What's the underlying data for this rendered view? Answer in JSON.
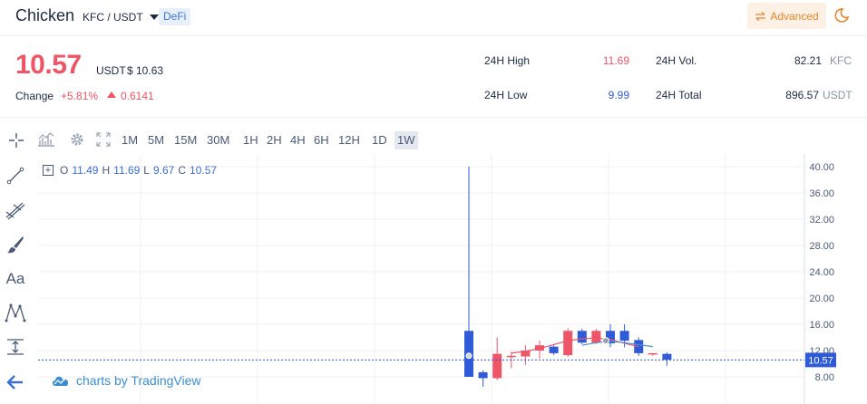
{
  "header": {
    "coin_name": "Chicken",
    "pair": "KFC / USDT",
    "badge": "DeFi",
    "advanced_label": "Advanced"
  },
  "ticker": {
    "price": "10.57",
    "price_unit": "USDT",
    "price_fiat": "$ 10.63",
    "change_label": "Change",
    "change_pct": "+5.81%",
    "change_abs": "0.6141",
    "high_label": "24H High",
    "high_value": "11.69",
    "low_label": "24H Low",
    "low_value": "9.99",
    "vol_label": "24H Vol.",
    "vol_value": "82.21",
    "vol_unit": "KFC",
    "total_label": "24H Total",
    "total_value": "896.57",
    "total_unit": "USDT"
  },
  "colors": {
    "up": "#ee5567",
    "down": "#2f5ad8",
    "accent": "#e8862d",
    "high": "#ee5567",
    "low": "#2f5ad8"
  },
  "toolbar": {
    "intervals": [
      "1M",
      "5M",
      "15M",
      "30M",
      "1H",
      "2H",
      "4H",
      "6H",
      "12H",
      "1D",
      "1W"
    ],
    "active_interval": "1W",
    "icons": [
      "crosshair-icon",
      "indicators-icon",
      "settings-icon",
      "fullscreen-icon"
    ]
  },
  "tools": [
    "crosshair-icon",
    "trend-line-icon",
    "fib-icon",
    "brush-icon",
    "text-tool",
    "pattern-icon",
    "measure-icon",
    "back-arrow-icon"
  ],
  "text_tool_label": "Aa",
  "ohlc": {
    "o_label": "O",
    "o": "11.49",
    "h_label": "H",
    "h": "11.69",
    "l_label": "L",
    "l": "9.67",
    "c_label": "C",
    "c": "10.57"
  },
  "watermark": "charts by TradingView",
  "chart_data": {
    "type": "candlestick",
    "y_ticks": [
      "40.00",
      "36.00",
      "32.00",
      "28.00",
      "24.00",
      "20.00",
      "16.00",
      "12.00",
      "8.00"
    ],
    "ylim": [
      4.5,
      40.5
    ],
    "last_price": "10.57",
    "candles": [
      {
        "o": 15.0,
        "h": 40.0,
        "l": 8.0,
        "c": 8.0
      },
      {
        "o": 8.7,
        "h": 9.0,
        "l": 6.5,
        "c": 7.8
      },
      {
        "o": 7.8,
        "h": 14.0,
        "l": 7.5,
        "c": 11.5
      },
      {
        "o": 11.0,
        "h": 11.8,
        "l": 9.3,
        "c": 11.2
      },
      {
        "o": 11.1,
        "h": 12.8,
        "l": 9.8,
        "c": 12.0
      },
      {
        "o": 12.0,
        "h": 13.5,
        "l": 10.8,
        "c": 12.8
      },
      {
        "o": 12.6,
        "h": 12.8,
        "l": 11.3,
        "c": 11.6
      },
      {
        "o": 11.3,
        "h": 15.4,
        "l": 11.0,
        "c": 15.0
      },
      {
        "o": 15.0,
        "h": 15.3,
        "l": 13.0,
        "c": 13.2
      },
      {
        "o": 13.2,
        "h": 15.3,
        "l": 13.0,
        "c": 15.0
      },
      {
        "o": 15.0,
        "h": 16.0,
        "l": 12.5,
        "c": 13.1
      },
      {
        "o": 15.0,
        "h": 16.0,
        "l": 12.5,
        "c": 13.5
      },
      {
        "o": 13.6,
        "h": 14.0,
        "l": 11.2,
        "c": 11.6
      },
      {
        "o": 11.4,
        "h": 11.6,
        "l": 11.2,
        "c": 11.6
      },
      {
        "o": 11.5,
        "h": 11.7,
        "l": 9.7,
        "c": 10.6
      }
    ],
    "ma_red": [
      11.6,
      11.9,
      12.3,
      12.9,
      13.5,
      13.8,
      13.9,
      13.7,
      13.1,
      12.6
    ],
    "ma_blue": [
      12.8,
      13.2,
      13.4,
      13.2,
      12.9,
      12.6
    ]
  }
}
